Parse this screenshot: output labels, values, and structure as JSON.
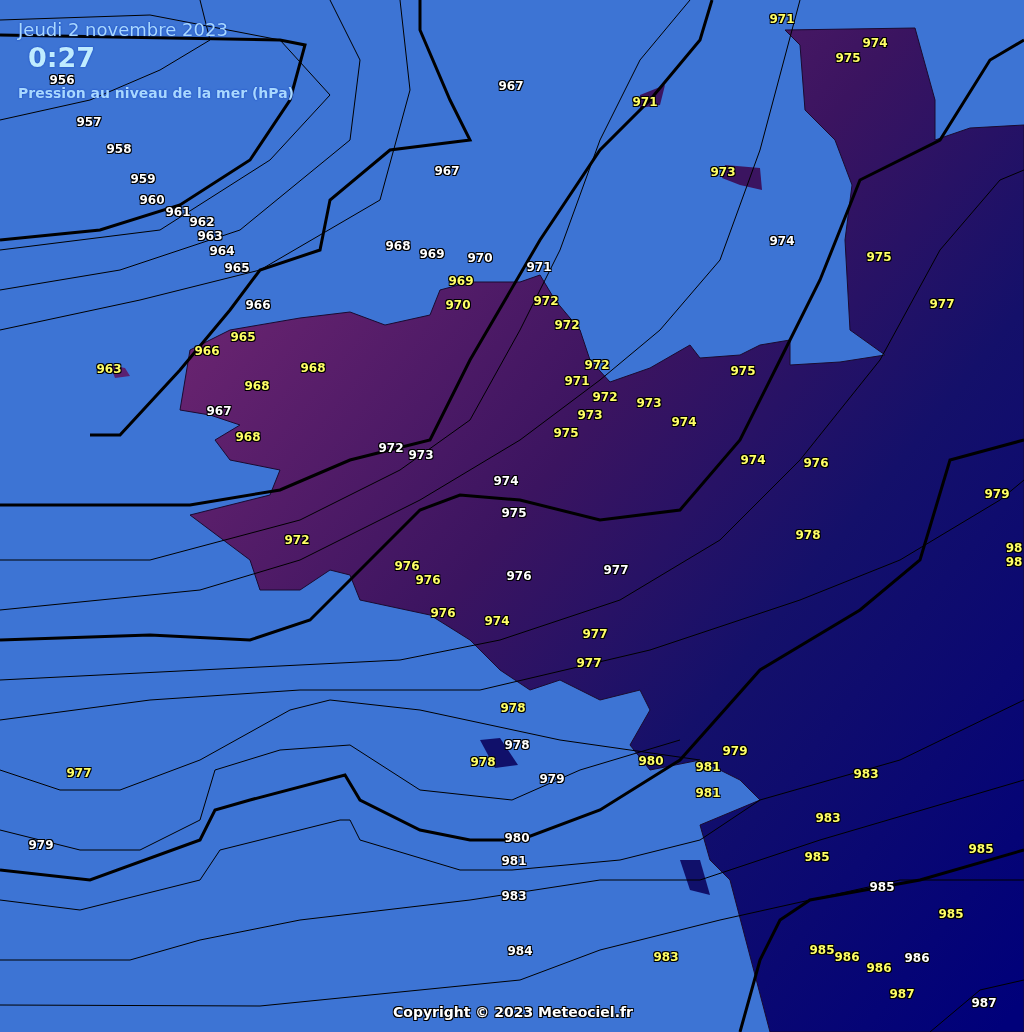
{
  "header": {
    "date": "Jeudi 2 novembre 2023",
    "time": "0:27",
    "subtitle": "Pression au niveau de la mer (hPa)"
  },
  "labels": [
    {
      "text": "971",
      "kind": "station"
    },
    {
      "text": "974",
      "kind": "station"
    },
    {
      "text": "975",
      "kind": "station"
    },
    {
      "text": "956",
      "kind": "isobar"
    },
    {
      "text": "967",
      "kind": "isobar"
    },
    {
      "text": "971",
      "kind": "station"
    },
    {
      "text": "957",
      "kind": "isobar"
    },
    {
      "text": "958",
      "kind": "isobar"
    },
    {
      "text": "967",
      "kind": "isobar"
    },
    {
      "text": "973",
      "kind": "station"
    },
    {
      "text": "959",
      "kind": "isobar"
    },
    {
      "text": "960",
      "kind": "isobar"
    },
    {
      "text": "961",
      "kind": "isobar"
    },
    {
      "text": "962",
      "kind": "isobar"
    },
    {
      "text": "963",
      "kind": "isobar"
    },
    {
      "text": "974",
      "kind": "isobar"
    },
    {
      "text": "964",
      "kind": "isobar"
    },
    {
      "text": "968",
      "kind": "isobar"
    },
    {
      "text": "969",
      "kind": "isobar"
    },
    {
      "text": "970",
      "kind": "isobar"
    },
    {
      "text": "975",
      "kind": "station"
    },
    {
      "text": "965",
      "kind": "isobar"
    },
    {
      "text": "971",
      "kind": "isobar"
    },
    {
      "text": "969",
      "kind": "station"
    },
    {
      "text": "966",
      "kind": "isobar"
    },
    {
      "text": "970",
      "kind": "station"
    },
    {
      "text": "972",
      "kind": "station"
    },
    {
      "text": "977",
      "kind": "station"
    },
    {
      "text": "972",
      "kind": "station"
    },
    {
      "text": "965",
      "kind": "station"
    },
    {
      "text": "966",
      "kind": "station"
    },
    {
      "text": "972",
      "kind": "station"
    },
    {
      "text": "963",
      "kind": "station"
    },
    {
      "text": "968",
      "kind": "station"
    },
    {
      "text": "975",
      "kind": "station"
    },
    {
      "text": "971",
      "kind": "station"
    },
    {
      "text": "968",
      "kind": "station"
    },
    {
      "text": "972",
      "kind": "station"
    },
    {
      "text": "973",
      "kind": "station"
    },
    {
      "text": "967",
      "kind": "isobar"
    },
    {
      "text": "973",
      "kind": "station"
    },
    {
      "text": "974",
      "kind": "station"
    },
    {
      "text": "975",
      "kind": "station"
    },
    {
      "text": "968",
      "kind": "station"
    },
    {
      "text": "972",
      "kind": "isobar"
    },
    {
      "text": "973",
      "kind": "isobar"
    },
    {
      "text": "974",
      "kind": "station"
    },
    {
      "text": "976",
      "kind": "station"
    },
    {
      "text": "974",
      "kind": "isobar"
    },
    {
      "text": "979",
      "kind": "station"
    },
    {
      "text": "975",
      "kind": "isobar"
    },
    {
      "text": "978",
      "kind": "station"
    },
    {
      "text": "972",
      "kind": "station"
    },
    {
      "text": "98",
      "kind": "station"
    },
    {
      "text": "98",
      "kind": "station"
    },
    {
      "text": "976",
      "kind": "station"
    },
    {
      "text": "977",
      "kind": "isobar"
    },
    {
      "text": "976",
      "kind": "isobar"
    },
    {
      "text": "976",
      "kind": "station"
    },
    {
      "text": "976",
      "kind": "station"
    },
    {
      "text": "974",
      "kind": "station"
    },
    {
      "text": "977",
      "kind": "station"
    },
    {
      "text": "977",
      "kind": "station"
    },
    {
      "text": "978",
      "kind": "station"
    },
    {
      "text": "978",
      "kind": "isobar"
    },
    {
      "text": "979",
      "kind": "station"
    },
    {
      "text": "980",
      "kind": "station"
    },
    {
      "text": "978",
      "kind": "station"
    },
    {
      "text": "981",
      "kind": "station"
    },
    {
      "text": "977",
      "kind": "station"
    },
    {
      "text": "983",
      "kind": "station"
    },
    {
      "text": "979",
      "kind": "isobar"
    },
    {
      "text": "981",
      "kind": "station"
    },
    {
      "text": "983",
      "kind": "station"
    },
    {
      "text": "980",
      "kind": "isobar"
    },
    {
      "text": "979",
      "kind": "isobar"
    },
    {
      "text": "985",
      "kind": "station"
    },
    {
      "text": "985",
      "kind": "station"
    },
    {
      "text": "981",
      "kind": "isobar"
    },
    {
      "text": "985",
      "kind": "isobar"
    },
    {
      "text": "983",
      "kind": "isobar"
    },
    {
      "text": "985",
      "kind": "station"
    },
    {
      "text": "984",
      "kind": "isobar"
    },
    {
      "text": "983",
      "kind": "station"
    },
    {
      "text": "985",
      "kind": "station"
    },
    {
      "text": "986",
      "kind": "station"
    },
    {
      "text": "986",
      "kind": "station"
    },
    {
      "text": "986",
      "kind": "isobar"
    },
    {
      "text": "987",
      "kind": "station"
    },
    {
      "text": "987",
      "kind": "isobar"
    }
  ],
  "copyright": "Copyright © 2023 Meteociel.fr"
}
